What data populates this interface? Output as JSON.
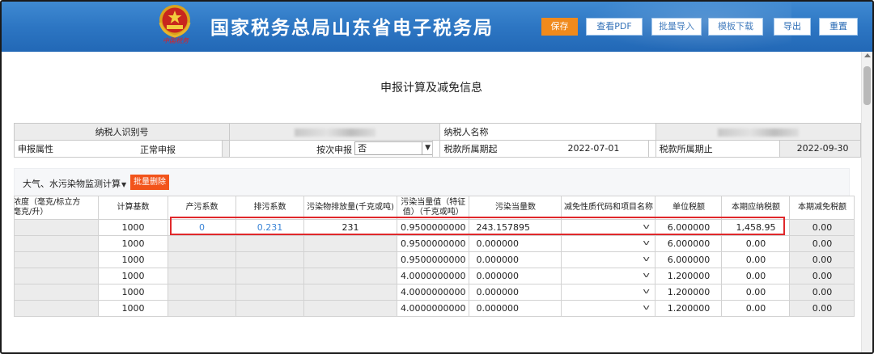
{
  "header": {
    "title": "国家税务总局山东省电子税务局",
    "emblem_caption": "中国税务",
    "buttons": {
      "save": "保存",
      "view_pdf": "查看PDF",
      "batch_import": "批量导入",
      "template_download": "模板下载",
      "export": "导出",
      "reset": "重置"
    }
  },
  "page": {
    "title": "申报计算及减免信息"
  },
  "info": {
    "taxpayer_id_label": "纳税人识别号",
    "taxpayer_name_label": "纳税人名称",
    "declare_attr_label": "申报属性",
    "declare_attr_value": "正常申报",
    "per_time_label": "按次申报",
    "per_time_value": "否",
    "period_start_label": "税款所属期起",
    "period_start_value": "2022-07-01",
    "period_end_label": "税款所属期止",
    "period_end_value": "2022-09-30"
  },
  "section": {
    "title": "大气、水污染物监测计算",
    "batch_delete": "批量删除"
  },
  "grid": {
    "headers": {
      "max_conc": "最高浓度（毫克/标立方米、毫克/升）",
      "calc_base": "计算基数",
      "prod_coef": "产污系数",
      "emit_coef": "排污系数",
      "emission": "污染物排放量(千克或吨)",
      "equiv_value": "污染当量值（特征值）（千克或吨）",
      "equiv_count": "污染当量数",
      "relief_code": "减免性质代码和项目名称",
      "unit_tax": "单位税额",
      "tax_due": "本期应纳税额",
      "tax_relief": "本期减免税额"
    },
    "rows": [
      {
        "calc_base": "1000",
        "prod_coef": "0",
        "emit_coef": "0.231",
        "emission": "231",
        "equiv_value": "0.9500000000",
        "equiv_count": "243.157895",
        "unit_tax": "6.000000",
        "tax_due": "1,458.95",
        "tax_relief": "0.00"
      },
      {
        "calc_base": "1000",
        "prod_coef": "",
        "emit_coef": "",
        "emission": "",
        "equiv_value": "0.9500000000",
        "equiv_count": "0.000000",
        "unit_tax": "6.000000",
        "tax_due": "0.00",
        "tax_relief": "0.00"
      },
      {
        "calc_base": "1000",
        "prod_coef": "",
        "emit_coef": "",
        "emission": "",
        "equiv_value": "0.9500000000",
        "equiv_count": "0.000000",
        "unit_tax": "6.000000",
        "tax_due": "0.00",
        "tax_relief": "0.00"
      },
      {
        "calc_base": "1000",
        "prod_coef": "",
        "emit_coef": "",
        "emission": "",
        "equiv_value": "4.0000000000",
        "equiv_count": "0.000000",
        "unit_tax": "1.200000",
        "tax_due": "0.00",
        "tax_relief": "0.00"
      },
      {
        "calc_base": "1000",
        "prod_coef": "",
        "emit_coef": "",
        "emission": "",
        "equiv_value": "4.0000000000",
        "equiv_count": "0.000000",
        "unit_tax": "1.200000",
        "tax_due": "0.00",
        "tax_relief": "0.00"
      },
      {
        "calc_base": "1000",
        "prod_coef": "",
        "emit_coef": "",
        "emission": "",
        "equiv_value": "4.0000000000",
        "equiv_count": "0.000000",
        "unit_tax": "1.200000",
        "tax_due": "0.00",
        "tax_relief": "0.00"
      }
    ]
  },
  "colors": {
    "header_blue": "#2d76c3",
    "primary_orange": "#f08a1c",
    "delete_red": "#f2541b",
    "highlight_red": "#e0282b",
    "link_blue": "#3a84d6"
  },
  "icons": {
    "emblem": "tax-emblem-icon",
    "dropdown": "chevron-down-icon"
  }
}
